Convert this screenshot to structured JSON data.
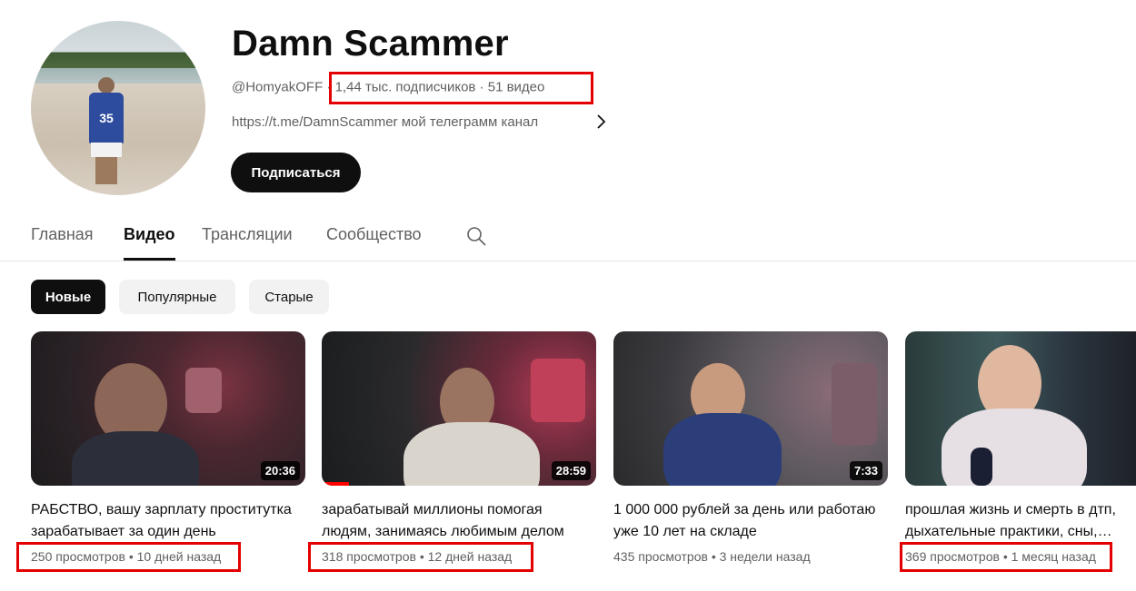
{
  "channel": {
    "name": "Damn Scammer",
    "handle": "@HomyakOFF",
    "sep1": "·",
    "subscribers": "1,44 тыс. подписчиков",
    "sep2": "·",
    "video_count": "51 видео",
    "link_text": "https://t.me/DamnScammer мой телеграмм канал",
    "jersey_number": "35",
    "subscribe_label": "Подписаться"
  },
  "tabs": [
    {
      "label": "Главная",
      "active": false
    },
    {
      "label": "Видео",
      "active": true
    },
    {
      "label": "Трансляции",
      "active": false
    },
    {
      "label": "Сообщество",
      "active": false
    }
  ],
  "chips": [
    {
      "label": "Новые",
      "active": true
    },
    {
      "label": "Популярные",
      "active": false
    },
    {
      "label": "Старые",
      "active": false
    }
  ],
  "videos": [
    {
      "title": "РАБСТВО, вашу зарплату проститутка зарабатывает за один день",
      "duration": "20:36",
      "views": "250 просмотров",
      "sep": "•",
      "age": "10 дней назад"
    },
    {
      "title": "зарабатывай миллионы помогая людям, занимаясь любимым делом",
      "duration": "28:59",
      "views": "318 просмотров",
      "sep": "•",
      "age": "12 дней назад",
      "watched_fraction": 0.1
    },
    {
      "title": "1 000 000 рублей за день или работаю уже 10 лет на складе",
      "duration": "7:33",
      "views": "435 просмотров",
      "sep": "•",
      "age": "3 недели назад"
    },
    {
      "title": "прошлая жизнь и смерть в дтп, дыхательные практики, сны, осознанность",
      "duration": "",
      "views": "369 просмотров",
      "sep": "•",
      "age": "1 месяц назад"
    }
  ],
  "colors": {
    "highlight_box": "#e40000",
    "accent_progress": "#ff0000"
  }
}
